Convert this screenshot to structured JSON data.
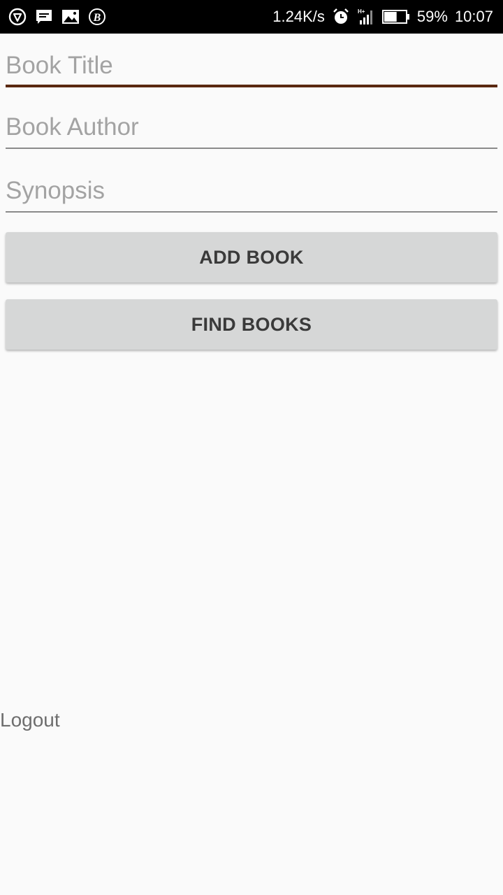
{
  "status_bar": {
    "left_icons": [
      "vpn-shield-icon",
      "message-icon",
      "image-icon",
      "b-app-icon"
    ],
    "net_speed": "1.24K/s",
    "right_icons": [
      "alarm-icon",
      "signal-icon",
      "battery-icon"
    ],
    "network_type": "H+",
    "battery_percent": "59%",
    "battery_level": 0.59,
    "time": "10:07"
  },
  "form": {
    "title_placeholder": "Book Title",
    "title_value": "",
    "author_placeholder": "Book Author",
    "author_value": "",
    "synopsis_placeholder": "Synopsis",
    "synopsis_value": ""
  },
  "buttons": {
    "add_label": "ADD BOOK",
    "find_label": "FIND BOOKS"
  },
  "logout_label": "Logout",
  "colors": {
    "focus_underline": "#5a2810",
    "button_bg": "#d6d7d7",
    "background": "#fafafa"
  }
}
